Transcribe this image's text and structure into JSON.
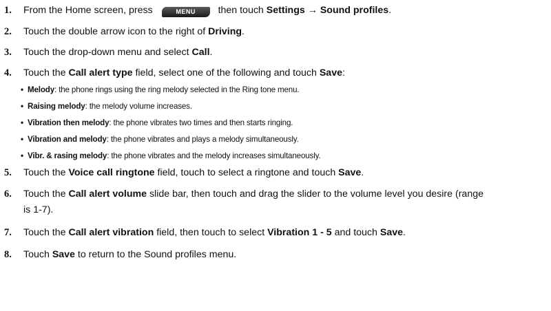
{
  "steps": [
    {
      "num": "1.",
      "p1": "From the Home screen, press",
      "key": "MENU",
      "p2": " then touch ",
      "b1": "Settings → Sound profiles",
      "p3": "."
    },
    {
      "num": "2.",
      "p1": "Touch the double arrow icon to the right of ",
      "b1": "Driving",
      "p2": "."
    },
    {
      "num": "3.",
      "p1": "Touch the drop-down menu and select ",
      "b1": "Call",
      "p2": "."
    },
    {
      "num": "4.",
      "p1": "Touch the ",
      "b1": "Call alert type",
      "p2": " field, select one of the following and touch ",
      "b2": "Save",
      "p3": ":"
    },
    {
      "num": "5.",
      "p1": "Touch the ",
      "b1": "Voice call ringtone",
      "p2": " field, touch to select a ringtone and touch ",
      "b2": "Save",
      "p3": "."
    },
    {
      "num": "6.",
      "p1": "Touch the ",
      "b1": "Call alert volume",
      "p2": " slide bar, then touch and drag the slider to the volume level you desire (range",
      "line2": "is 1-7)."
    },
    {
      "num": "7.",
      "p1": "Touch the ",
      "b1": "Call alert vibration",
      "p2": " field, then touch to select ",
      "b2": "Vibration 1 - 5",
      "p3": " and touch ",
      "b3": "Save",
      "p4": "."
    },
    {
      "num": "8.",
      "p1": "Touch ",
      "b1": "Save",
      "p2": " to return to the Sound profiles menu."
    }
  ],
  "bullets": [
    {
      "term": "Melody",
      "desc": ": the phone rings using the ring melody selected in the Ring tone menu."
    },
    {
      "term": "Raising melody",
      "desc": ": the melody volume increases."
    },
    {
      "term": "Vibration then melody",
      "desc": ": the phone vibrates two times and then starts ringing."
    },
    {
      "term": "Vibration and melody",
      "desc": ": the phone vibrates and plays a melody simultaneously."
    },
    {
      "term": "Vibr. & rasing melody",
      "desc": ": the phone vibrates and the melody increases simultaneously."
    }
  ]
}
